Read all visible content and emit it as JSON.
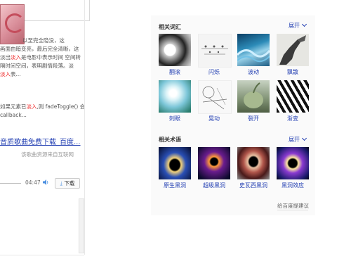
{
  "left": {
    "snippet_a": [
      {
        "pre": "",
        "hl": "",
        "post": "以至完全隐没，这"
      },
      {
        "pre": "画面由暗变亮，最后完全清晰，这",
        "hl": "",
        "post": ""
      },
      {
        "pre": "淡出",
        "hl": "淡入",
        "post": "是电影中表示时间 空间转"
      },
      {
        "pre": "隔时间空间，表明剧情段落。淡",
        "hl": "",
        "post": ""
      },
      {
        "pre": "",
        "hl": "淡入",
        "post": "表..."
      }
    ],
    "snippet_b": [
      {
        "pre": "如果元素已",
        "hl": "淡入",
        "post": ",则 fadeToggle() 会"
      },
      {
        "pre": "callback...",
        "hl": "",
        "post": ""
      }
    ],
    "result_link": "音质歌曲免费下载_百度...",
    "source_note": "该歌曲资源来自互联网",
    "player": {
      "time": "04:47",
      "download": "下载",
      "progress": 0
    }
  },
  "related_words": {
    "title": "相关词汇",
    "expand": "展开",
    "items": [
      {
        "label": "翻滚"
      },
      {
        "label": "闪烁"
      },
      {
        "label": "波动"
      },
      {
        "label": "飘散"
      },
      {
        "label": "刺眼"
      },
      {
        "label": "晃动"
      },
      {
        "label": "裂开"
      },
      {
        "label": "渐变"
      }
    ]
  },
  "related_terms": {
    "title": "相关术语",
    "expand": "展开",
    "items": [
      {
        "label": "原生黑洞"
      },
      {
        "label": "超级黑洞"
      },
      {
        "label": "史瓦西黑洞"
      },
      {
        "label": "黑洞效应"
      }
    ]
  },
  "feedback": "给百度提建议",
  "colors": {
    "link": "#2440b3",
    "highlight": "#e22222"
  }
}
